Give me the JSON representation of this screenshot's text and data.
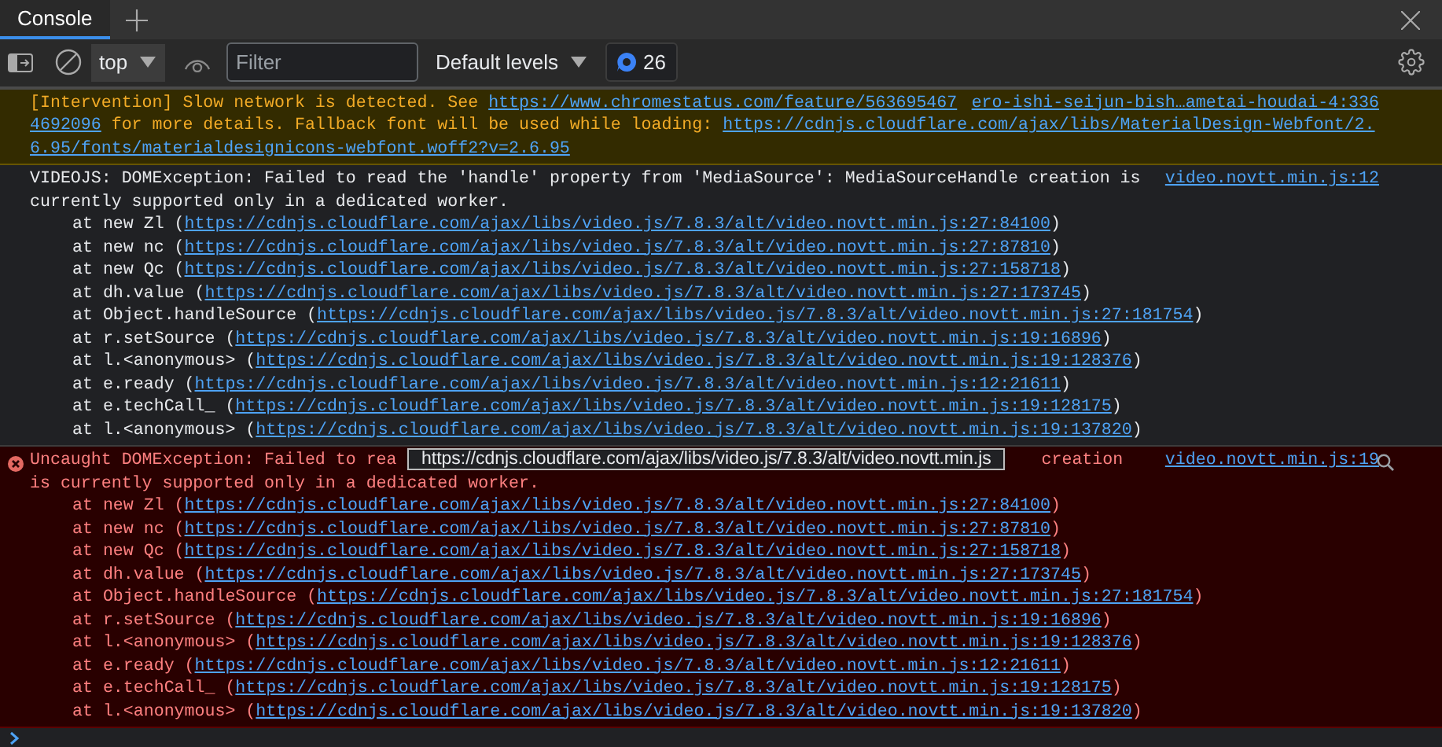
{
  "tabs": [
    {
      "label": "Console",
      "selected": true
    }
  ],
  "toolbar": {
    "context": "top",
    "filter": {
      "placeholder": "Filter"
    },
    "levels": "Default levels",
    "message_count": "26"
  },
  "messages": [
    {
      "kind": "warning",
      "source": "ero-ishi-seijun-bish…ametai-houdai-4:336",
      "lines": [
        [
          {
            "kind": "text",
            "text": "[Intervention] Slow network is detected. See "
          },
          {
            "kind": "link",
            "text": "https://www.chromestatus.com/feature/563695467"
          }
        ],
        [
          {
            "kind": "link",
            "text": "4692096"
          },
          {
            "kind": "text",
            "text": " for more details. Fallback font will be used while loading: "
          },
          {
            "kind": "link",
            "text": "https://cdnjs.cloudflare.com/ajax/libs/MaterialDesign-Webfont/2."
          }
        ],
        [
          {
            "kind": "link",
            "text": "6.95/fonts/materialdesignicons-webfont.woff2?v=2.6.95"
          }
        ]
      ]
    },
    {
      "kind": "info",
      "source": "video.novtt.min.js:12",
      "lines": [
        [
          {
            "kind": "text",
            "text": "VIDEOJS: DOMException: Failed to read the 'handle' property from 'MediaSource': MediaSourceHandle creation is"
          }
        ],
        [
          {
            "kind": "text",
            "text": "currently supported only in a dedicated worker."
          }
        ]
      ],
      "stack": [
        {
          "prefix": "at new Zl (",
          "url": "https://cdnjs.cloudflare.com/ajax/libs/video.js/7.8.3/alt/video.novtt.min.js:27:84100",
          "suffix": ")"
        },
        {
          "prefix": "at new nc (",
          "url": "https://cdnjs.cloudflare.com/ajax/libs/video.js/7.8.3/alt/video.novtt.min.js:27:87810",
          "suffix": ")"
        },
        {
          "prefix": "at new Qc (",
          "url": "https://cdnjs.cloudflare.com/ajax/libs/video.js/7.8.3/alt/video.novtt.min.js:27:158718",
          "suffix": ")"
        },
        {
          "prefix": "at dh.value (",
          "url": "https://cdnjs.cloudflare.com/ajax/libs/video.js/7.8.3/alt/video.novtt.min.js:27:173745",
          "suffix": ")"
        },
        {
          "prefix": "at Object.handleSource (",
          "url": "https://cdnjs.cloudflare.com/ajax/libs/video.js/7.8.3/alt/video.novtt.min.js:27:181754",
          "suffix": ")"
        },
        {
          "prefix": "at r.setSource (",
          "url": "https://cdnjs.cloudflare.com/ajax/libs/video.js/7.8.3/alt/video.novtt.min.js:19:16896",
          "suffix": ")"
        },
        {
          "prefix": "at l.<anonymous> (",
          "url": "https://cdnjs.cloudflare.com/ajax/libs/video.js/7.8.3/alt/video.novtt.min.js:19:128376",
          "suffix": ")"
        },
        {
          "prefix": "at e.ready (",
          "url": "https://cdnjs.cloudflare.com/ajax/libs/video.js/7.8.3/alt/video.novtt.min.js:12:21611",
          "suffix": ")"
        },
        {
          "prefix": "at e.techCall_ (",
          "url": "https://cdnjs.cloudflare.com/ajax/libs/video.js/7.8.3/alt/video.novtt.min.js:19:128175",
          "suffix": ")"
        },
        {
          "prefix": "at l.<anonymous> (",
          "url": "https://cdnjs.cloudflare.com/ajax/libs/video.js/7.8.3/alt/video.novtt.min.js:19:137820",
          "suffix": ")"
        }
      ]
    },
    {
      "kind": "error",
      "source": "video.novtt.min.js:19",
      "tooltip": "https://cdnjs.cloudflare.com/ajax/libs/video.js/7.8.3/alt/video.novtt.min.js",
      "lines": [
        [
          {
            "kind": "text",
            "text": "Uncaught DOMException: Failed to rea"
          },
          {
            "kind": "after_cover",
            "text": "creation"
          }
        ],
        [
          {
            "kind": "text",
            "text": "is currently supported only in a dedicated worker."
          }
        ]
      ],
      "stack": [
        {
          "prefix": "at new Zl (",
          "url": "https://cdnjs.cloudflare.com/ajax/libs/video.js/7.8.3/alt/video.novtt.min.js:27:84100",
          "suffix": ")"
        },
        {
          "prefix": "at new nc (",
          "url": "https://cdnjs.cloudflare.com/ajax/libs/video.js/7.8.3/alt/video.novtt.min.js:27:87810",
          "suffix": ")"
        },
        {
          "prefix": "at new Qc (",
          "url": "https://cdnjs.cloudflare.com/ajax/libs/video.js/7.8.3/alt/video.novtt.min.js:27:158718",
          "suffix": ")"
        },
        {
          "prefix": "at dh.value (",
          "url": "https://cdnjs.cloudflare.com/ajax/libs/video.js/7.8.3/alt/video.novtt.min.js:27:173745",
          "suffix": ")"
        },
        {
          "prefix": "at Object.handleSource (",
          "url": "https://cdnjs.cloudflare.com/ajax/libs/video.js/7.8.3/alt/video.novtt.min.js:27:181754",
          "suffix": ")"
        },
        {
          "prefix": "at r.setSource (",
          "url": "https://cdnjs.cloudflare.com/ajax/libs/video.js/7.8.3/alt/video.novtt.min.js:19:16896",
          "suffix": ")"
        },
        {
          "prefix": "at l.<anonymous> (",
          "url": "https://cdnjs.cloudflare.com/ajax/libs/video.js/7.8.3/alt/video.novtt.min.js:19:128376",
          "suffix": ")"
        },
        {
          "prefix": "at e.ready (",
          "url": "https://cdnjs.cloudflare.com/ajax/libs/video.js/7.8.3/alt/video.novtt.min.js:12:21611",
          "suffix": ")"
        },
        {
          "prefix": "at e.techCall_ (",
          "url": "https://cdnjs.cloudflare.com/ajax/libs/video.js/7.8.3/alt/video.novtt.min.js:19:128175",
          "suffix": ")"
        },
        {
          "prefix": "at l.<anonymous> (",
          "url": "https://cdnjs.cloudflare.com/ajax/libs/video.js/7.8.3/alt/video.novtt.min.js:19:137820",
          "suffix": ")"
        }
      ]
    }
  ]
}
